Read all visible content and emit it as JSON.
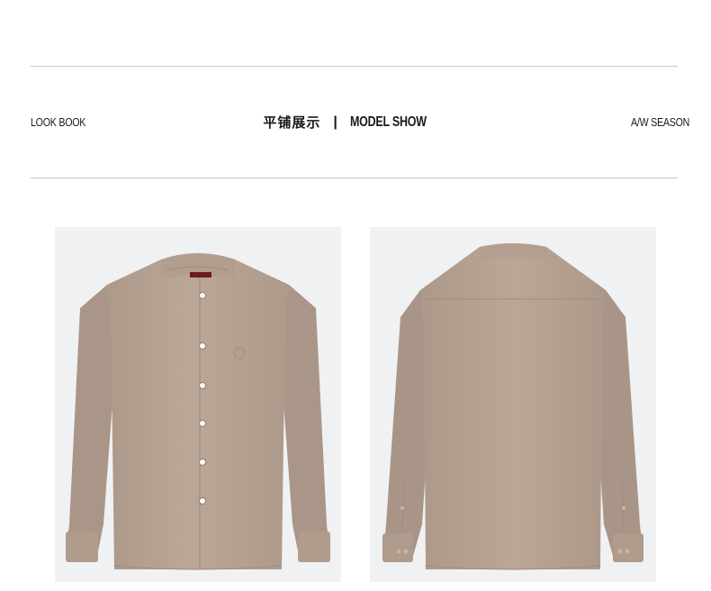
{
  "header": {
    "left_label": "LOOK BOOK",
    "title_cn": "平铺展示",
    "separator": "|",
    "title_en": "MODEL SHOW",
    "right_label": "A/W SEASON"
  },
  "colors": {
    "rule": "#c8c8c8",
    "photo_background": "#f0f1f3",
    "shirt": "#b7a393",
    "text": "#1a1a1a"
  },
  "gallery": {
    "images": [
      {
        "name": "shirt-front",
        "alt": "shirt-front-view"
      },
      {
        "name": "shirt-back",
        "alt": "shirt-back-view"
      }
    ]
  }
}
